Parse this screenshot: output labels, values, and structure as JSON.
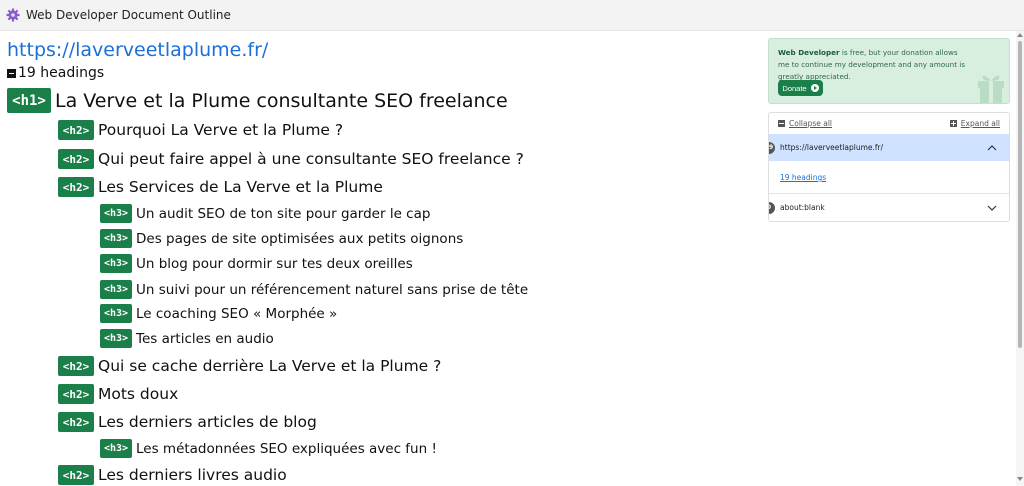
{
  "window": {
    "title": "Web Developer Document Outline"
  },
  "outline": {
    "url": "https://laverveetlaplume.fr/",
    "heading_count": "19 headings",
    "headings": [
      {
        "tag": "<h1>",
        "text": "La Verve et la Plume consultante SEO freelance"
      },
      {
        "tag": "<h2>",
        "text": "Pourquoi La Verve et la Plume ?"
      },
      {
        "tag": "<h2>",
        "text": "Qui peut faire appel à une consultante SEO freelance ?"
      },
      {
        "tag": "<h2>",
        "text": "Les Services de La Verve et la Plume"
      },
      {
        "tag": "<h3>",
        "text": "Un audit SEO de ton site pour garder le cap"
      },
      {
        "tag": "<h3>",
        "text": "Des pages de site optimisées aux petits oignons"
      },
      {
        "tag": "<h3>",
        "text": "Un blog pour dormir sur tes deux oreilles"
      },
      {
        "tag": "<h3>",
        "text": "Un suivi pour un référencement naturel sans prise de tête"
      },
      {
        "tag": "<h3>",
        "text": "Le coaching SEO « Morphée »"
      },
      {
        "tag": "<h3>",
        "text": "Tes articles en audio"
      },
      {
        "tag": "<h2>",
        "text": "Qui se cache derrière La Verve et la Plume ?"
      },
      {
        "tag": "<h2>",
        "text": "Mots doux"
      },
      {
        "tag": "<h2>",
        "text": "Les derniers articles de blog"
      },
      {
        "tag": "<h3>",
        "text": "Les métadonnées SEO expliquées avec fun !"
      },
      {
        "tag": "<h2>",
        "text": "Les derniers livres audio"
      }
    ]
  },
  "donate": {
    "brand": "Web Developer",
    "message": " is free, but your donation allows me to continue my development and any amount is greatly appreciated.",
    "button_label": "Donate"
  },
  "panel": {
    "collapse_label": "Collapse all",
    "expand_label": "Expand all",
    "pages": [
      {
        "count": "19",
        "url": "https://laverveetlaplume.fr/",
        "link": "19 headings"
      },
      {
        "count": "0",
        "url": "about:blank"
      }
    ]
  },
  "colors": {
    "badge": "#1b7f4a",
    "link": "#1a6fd8",
    "selected_row": "#cfe2ff",
    "donate_bg": "#d8eedf"
  }
}
